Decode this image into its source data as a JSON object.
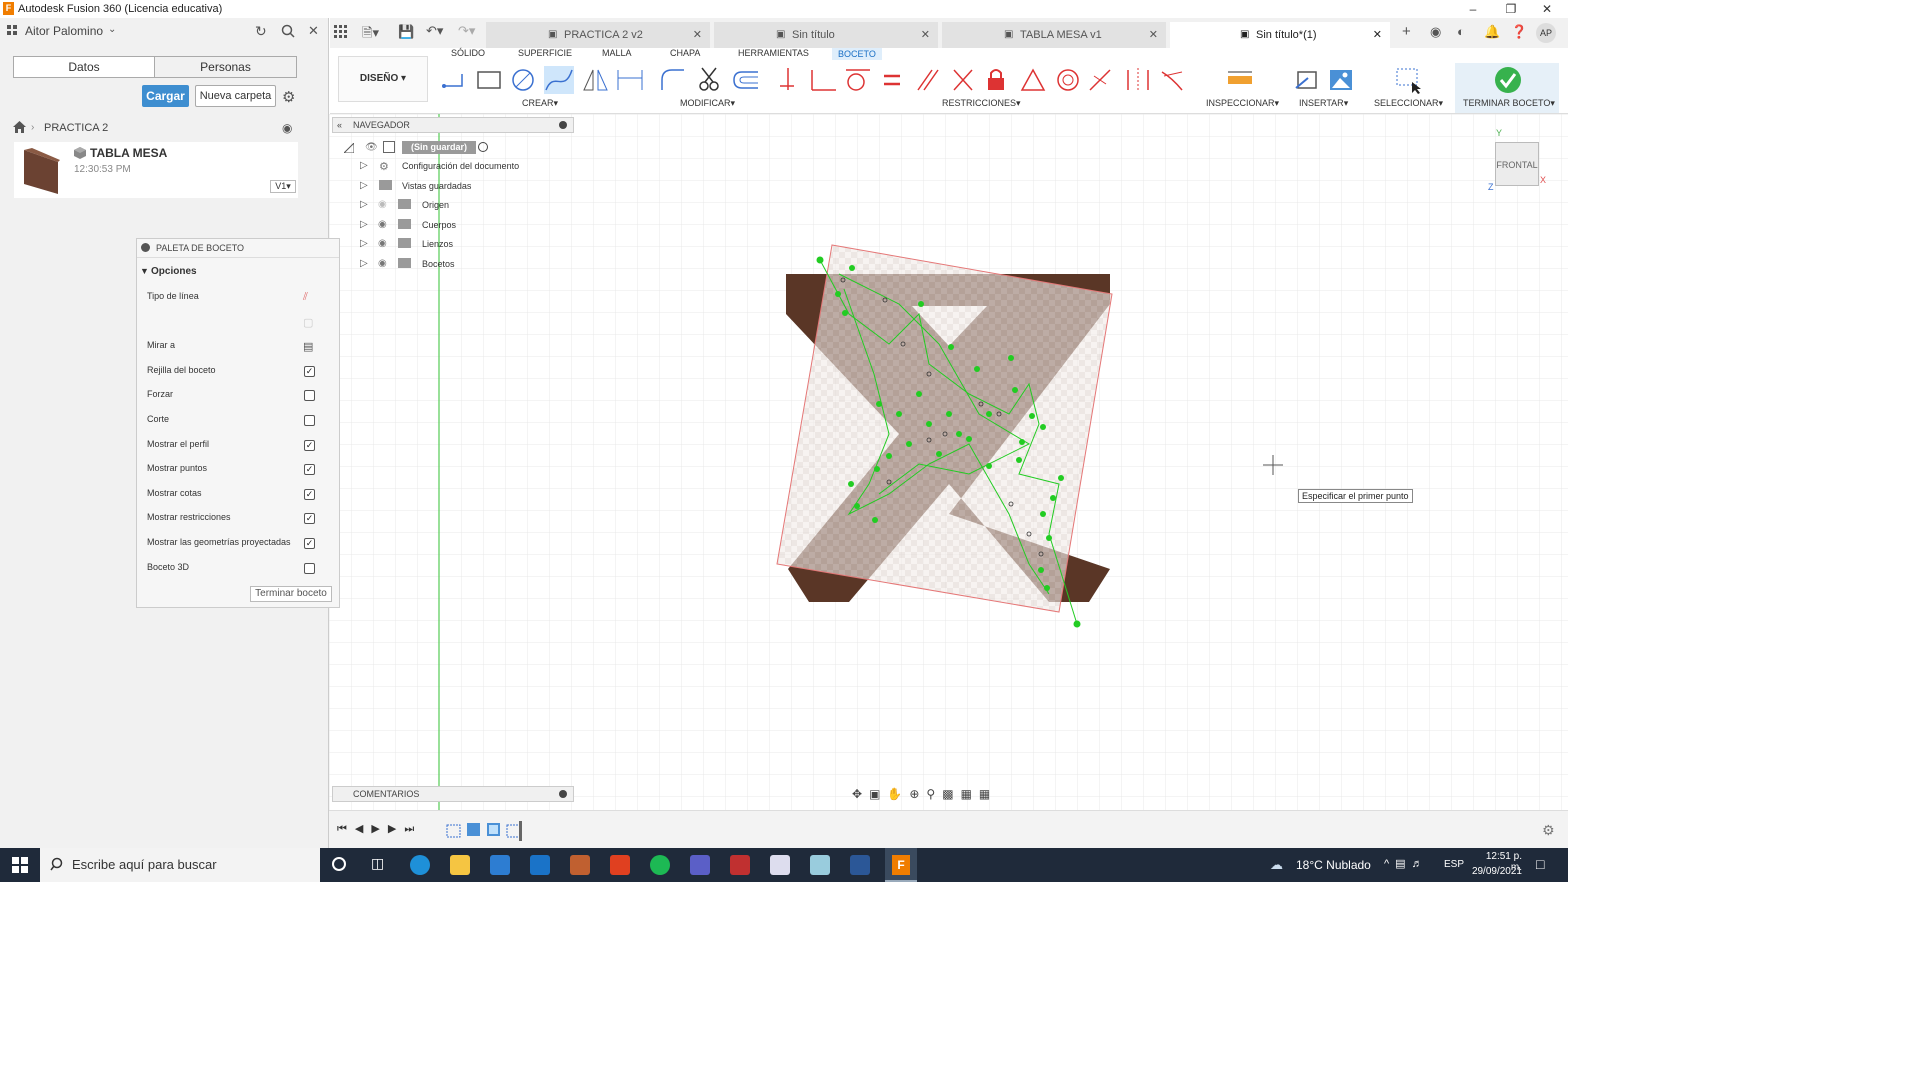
{
  "window": {
    "title": "Autodesk Fusion 360 (Licencia educativa)",
    "app_logo": "F"
  },
  "left_panel": {
    "user_name": "Aitor Palomino",
    "tabs": [
      "Datos",
      "Personas"
    ],
    "buttons": {
      "upload": "Cargar",
      "new_folder": "Nueva carpeta"
    },
    "breadcrumb": "PRACTICA 2",
    "file_card": {
      "name": "TABLA MESA",
      "time": "12:30:53 PM",
      "version": "V1"
    }
  },
  "palette": {
    "header": "PALETA DE BOCETO",
    "section": "Opciones",
    "rows": [
      {
        "label": "Tipo de línea",
        "kind": "icon",
        "checked": false
      },
      {
        "label": "",
        "kind": "icon2",
        "checked": false
      },
      {
        "label": "Mirar a",
        "kind": "icon3",
        "checked": false
      },
      {
        "label": "Rejilla del boceto",
        "kind": "check",
        "checked": true
      },
      {
        "label": "Forzar",
        "kind": "check",
        "checked": false
      },
      {
        "label": "Corte",
        "kind": "check",
        "checked": false
      },
      {
        "label": "Mostrar el perfil",
        "kind": "check",
        "checked": true
      },
      {
        "label": "Mostrar puntos",
        "kind": "check",
        "checked": true
      },
      {
        "label": "Mostrar cotas",
        "kind": "check",
        "checked": true
      },
      {
        "label": "Mostrar restricciones",
        "kind": "check",
        "checked": true
      },
      {
        "label": "Mostrar las geometrías proyectadas",
        "kind": "check",
        "checked": true
      },
      {
        "label": "Boceto 3D",
        "kind": "check",
        "checked": false
      }
    ],
    "finish_button": "Terminar boceto"
  },
  "doc_tabs": [
    {
      "label": "PRACTICA 2 v2",
      "active": false
    },
    {
      "label": "Sin título",
      "active": false
    },
    {
      "label": "TABLA MESA v1",
      "active": false
    },
    {
      "label": "Sin título*(1)",
      "active": true
    }
  ],
  "toolbar": {
    "workspace": "DISEÑO",
    "subtabs": [
      "SÓLIDO",
      "SUPERFICIE",
      "MALLA",
      "CHAPA",
      "HERRAMIENTAS",
      "BOCETO"
    ],
    "active_subtab": "BOCETO",
    "groups": {
      "create": "CREAR",
      "modify": "MODIFICAR",
      "constraints": "RESTRICCIONES",
      "inspect": "INSPECCIONAR",
      "insert": "INSERTAR",
      "select": "SELECCIONAR",
      "finish": "TERMINAR BOCETO"
    }
  },
  "navigator": {
    "title": "NAVEGADOR",
    "root": "(Sin guardar)",
    "items": [
      "Configuración del documento",
      "Vistas guardadas",
      "Origen",
      "Cuerpos",
      "Lienzos",
      "Bocetos"
    ]
  },
  "viewcube": {
    "face": "FRONTAL",
    "axis_x": "X",
    "axis_y": "Y",
    "axis_z": "Z"
  },
  "canvas_tooltip": "Especificar el primer punto",
  "comments": "COMENTARIOS",
  "taskbar": {
    "search_placeholder": "Escribe aquí para buscar",
    "weather": "18°C  Nublado",
    "language": "ESP",
    "time": "12:51 p. m.",
    "date": "29/09/2021"
  },
  "user_initials": "AP",
  "colors": {
    "accent": "#3e8ed0",
    "sketch_green": "#22cc22",
    "wood": "#5a3626",
    "taskbar": "#1f2a3a"
  }
}
